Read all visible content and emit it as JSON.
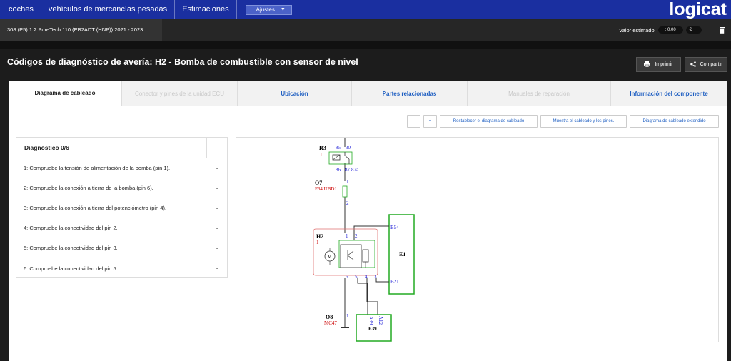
{
  "nav": {
    "items": [
      "coches",
      "vehículos de mercancías pesadas",
      "Estimaciones"
    ],
    "settings_label": "Ajustes",
    "logo": "logicat"
  },
  "vehicle": {
    "title": "308 (P5) 1.2 PureTech 110 (EB2ADT (HNP)) 2021 - 2023",
    "valor_label": "Valor estimado",
    "valor_value": ": 0,00",
    "currency": "€"
  },
  "page": {
    "title": "Códigos de diagnóstico de avería: H2 - Bomba de combustible con sensor de nivel",
    "print_label": "Imprimir",
    "share_label": "Compartir"
  },
  "tabs": [
    {
      "label": "Diagrama de cableado",
      "state": "active"
    },
    {
      "label": "Conector y pines de la unidad ECU",
      "state": "disabled"
    },
    {
      "label": "Ubicación",
      "state": "normal"
    },
    {
      "label": "Partes relacionadas",
      "state": "normal"
    },
    {
      "label": "Manuales de reparación",
      "state": "disabled"
    },
    {
      "label": "Información del componente",
      "state": "normal"
    }
  ],
  "controls": {
    "zoom_out": "-",
    "zoom_in": "+",
    "reset": "Restablecer el diagrama de cableado",
    "show_pins": "Muestra el cableado y los pines.",
    "extended": "Diagrama de cableado extendido"
  },
  "diagnosis": {
    "header": "Diagnóstico 0/6",
    "steps": [
      "1: Compruebe la tensión de alimentación de la bomba (pin 1).",
      "2: Compruebe la conexión a tierra de la bomba (pin 6).",
      "3: Compruebe la conexión a tierra del potenciómetro (pin 4).",
      "4: Compruebe la conectividad del pin 2.",
      "5: Compruebe la conectividad del pin 3.",
      "6: Compruebe la conectividad del pin 5."
    ]
  },
  "diagram": {
    "r3": {
      "name": "R3",
      "sub": "1",
      "pins": [
        "85",
        "30",
        "86",
        "87",
        "87a"
      ]
    },
    "o7": {
      "name": "O7",
      "sub": "F64 UBD1",
      "pins": [
        "1",
        "2"
      ]
    },
    "h2": {
      "name": "H2",
      "sub": "1",
      "pins": [
        "1",
        "2",
        "6",
        "5",
        "4",
        "3"
      ],
      "motor": "M"
    },
    "e1": {
      "name": "E1",
      "pins": [
        "B54",
        "B21"
      ]
    },
    "o8": {
      "name": "O8",
      "sub": "MC47",
      "pins": [
        "1"
      ]
    },
    "e39": {
      "name": "E39",
      "pins": [
        "A39",
        "A12"
      ]
    },
    "colors": {
      "component": "#cc0000",
      "pin": "#1a1ad6",
      "box": "#22aa22"
    }
  }
}
